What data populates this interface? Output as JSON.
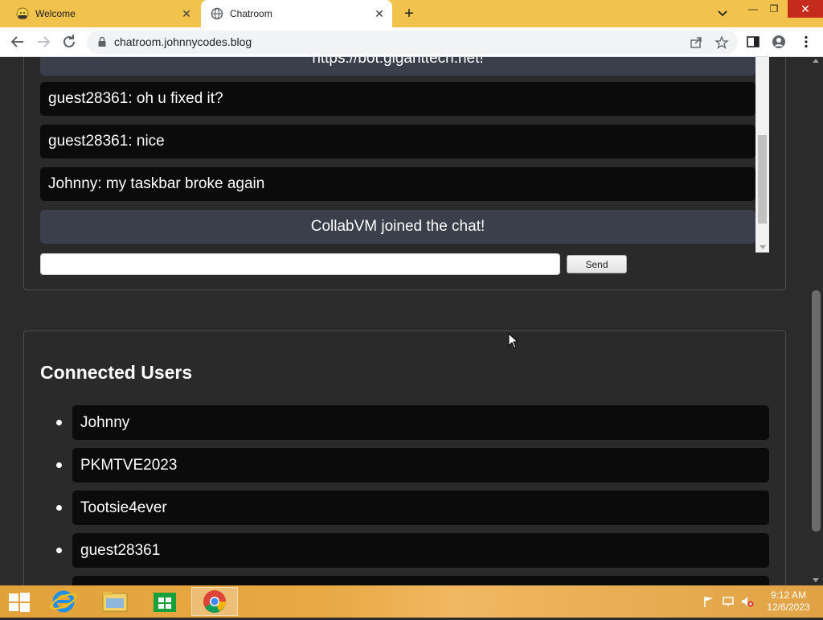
{
  "browser": {
    "tabs": [
      {
        "title": "Welcome",
        "active": false
      },
      {
        "title": "Chatroom",
        "active": true
      }
    ],
    "url": "chatroom.johnnycodes.blog"
  },
  "chat": {
    "messages": [
      {
        "text": "https://bot.giganttech.net!",
        "type": "system"
      },
      {
        "text": "guest28361: oh u fixed it?",
        "type": "user"
      },
      {
        "text": "guest28361: nice",
        "type": "user"
      },
      {
        "text": "Johnny: my taskbar broke again",
        "type": "user"
      },
      {
        "text": "CollabVM joined the chat!",
        "type": "system"
      }
    ],
    "input_value": "",
    "send_label": "Send"
  },
  "users": {
    "title": "Connected Users",
    "list": [
      "Johnny",
      "PKMTVE2023",
      "Tootsie4ever",
      "guest28361",
      ""
    ]
  },
  "taskbar": {
    "apps": [
      "internet-explorer",
      "file-explorer",
      "store",
      "chrome"
    ],
    "clock_time": "9:12 AM",
    "clock_date": "12/6/2023"
  },
  "colors": {
    "tabbar": "#f1c34d",
    "page_bg": "#2b2b2b",
    "message_bg": "#0b0b0b",
    "system_message_bg": "#3a3f4b",
    "close_button": "#c42b1c"
  }
}
